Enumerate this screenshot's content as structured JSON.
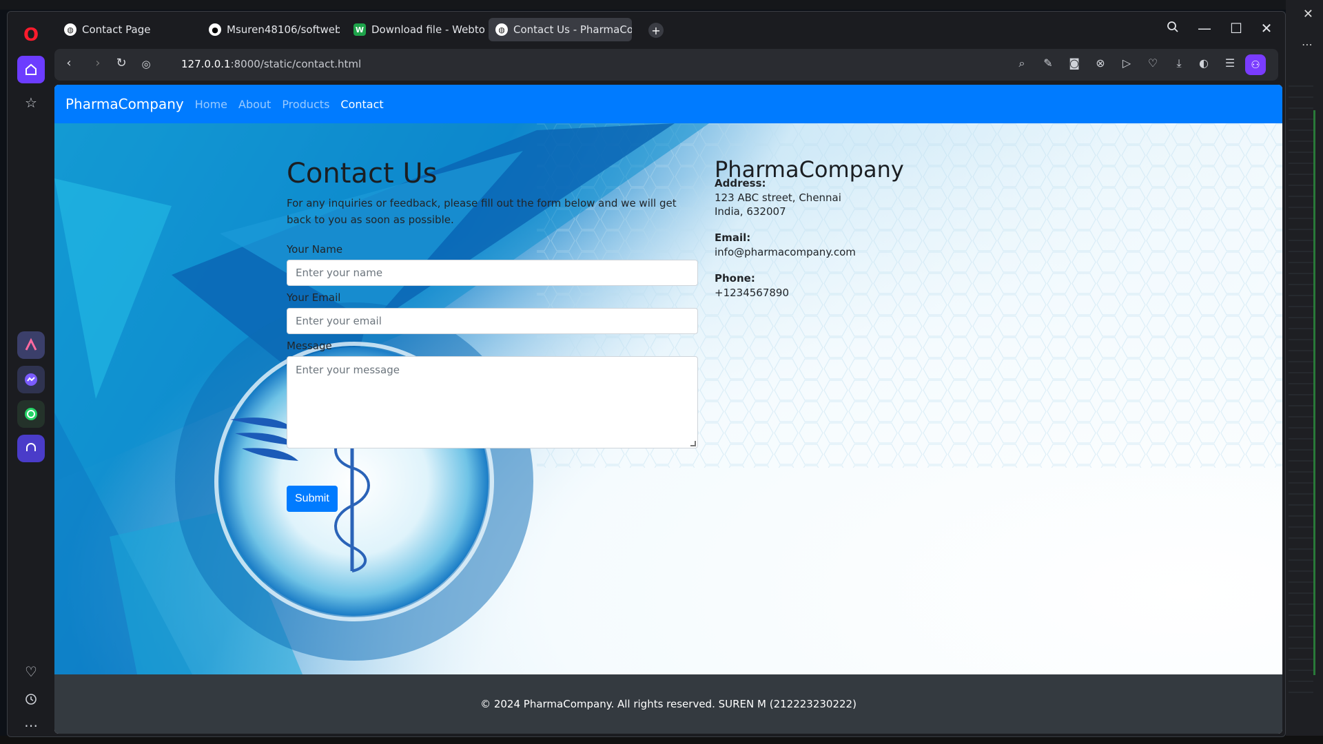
{
  "browser": {
    "tabs": [
      {
        "title": "Contact Page",
        "favicon": "globe-icon"
      },
      {
        "title": "Msuren48106/softweb",
        "favicon": "github-icon"
      },
      {
        "title": "Download file - Webtopdf",
        "favicon": "webtopdf-icon"
      },
      {
        "title": "Contact Us - PharmaCompany",
        "favicon": "globe-icon",
        "active": true
      }
    ],
    "url_host": "127.0.0.1",
    "url_rest": ":8000/static/contact.html"
  },
  "site": {
    "brand": "PharmaCompany",
    "nav": [
      "Home",
      "About",
      "Products",
      "Contact"
    ],
    "active_nav": "Contact"
  },
  "contact": {
    "title": "Contact Us",
    "intro": "For any inquiries or feedback, please fill out the form below and we will get back to you as soon as possible.",
    "name_label": "Your Name",
    "name_placeholder": "Enter your name",
    "email_label": "Your Email",
    "email_placeholder": "Enter your email",
    "message_label": "Message",
    "message_placeholder": "Enter your message",
    "submit_label": "Submit"
  },
  "info": {
    "brand": "PharmaCompany",
    "address_label": "Address:",
    "address_line1": "123 ABC street, Chennai",
    "address_line2": "India, 632007",
    "email_label": "Email:",
    "email": "info@pharmacompany.com",
    "phone_label": "Phone:",
    "phone": "+1234567890"
  },
  "footer": {
    "text": "© 2024 PharmaCompany. All rights reserved. SUREN M (212223230222)"
  },
  "colors": {
    "primary": "#007bff",
    "footer_bg": "#343a40",
    "opera_accent": "#6c3cff"
  }
}
